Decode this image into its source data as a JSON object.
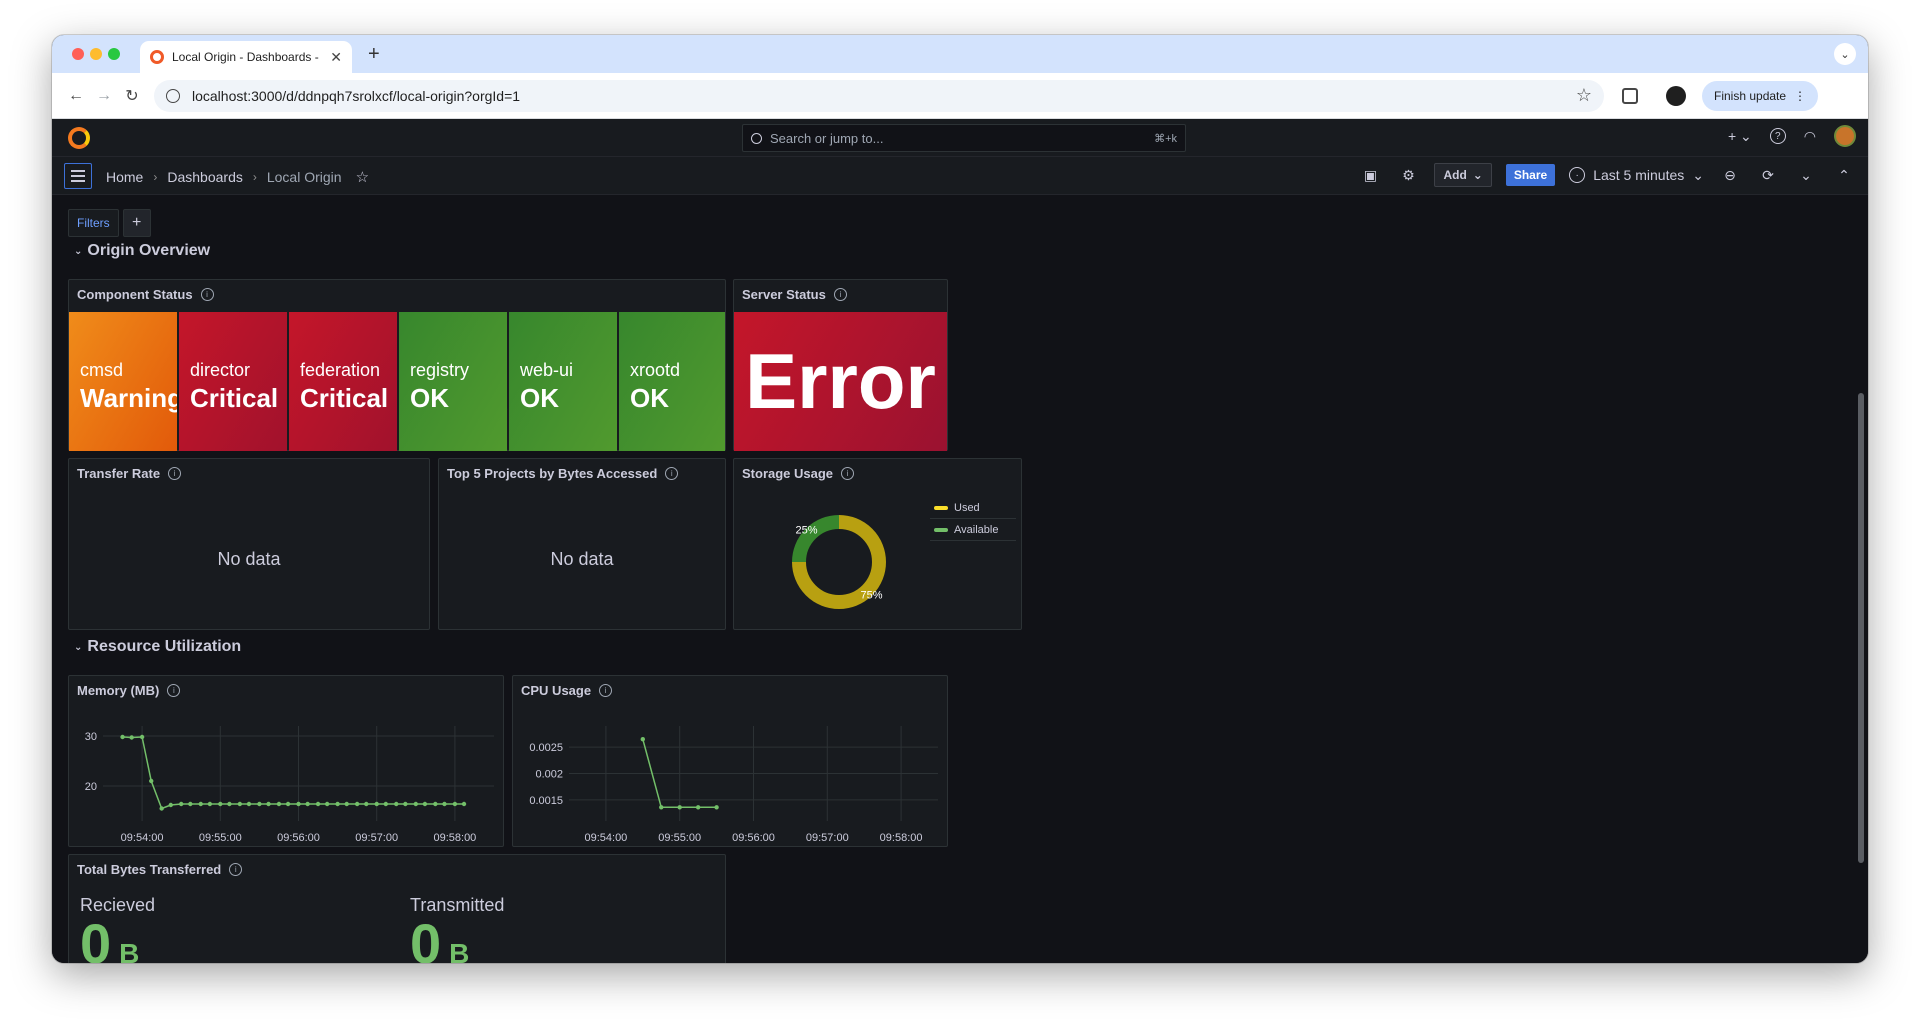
{
  "browser": {
    "tab_title": "Local Origin - Dashboards - Grafana",
    "url": "localhost:3000/d/ddnpqh7srolxcf/local-origin?orgId=1",
    "finish_update": "Finish update"
  },
  "grafana": {
    "search_placeholder": "Search or jump to...",
    "search_shortcut": "⌘+k",
    "breadcrumb": [
      "Home",
      "Dashboards",
      "Local Origin"
    ],
    "add_label": "Add",
    "share_label": "Share",
    "time_range": "Last 5 minutes",
    "filters_label": "Filters"
  },
  "rows": {
    "overview": "Origin Overview",
    "resources": "Resource Utilization"
  },
  "component_status": {
    "title": "Component Status",
    "tiles": [
      {
        "name": "cmsd",
        "value": "Warning",
        "color": "#e25a0a"
      },
      {
        "name": "director",
        "value": "Critical",
        "color": "#c4162a"
      },
      {
        "name": "federation",
        "value": "Critical",
        "color": "#c4162a"
      },
      {
        "name": "registry",
        "value": "OK",
        "color": "#37872d"
      },
      {
        "name": "web-ui",
        "value": "OK",
        "color": "#37872d"
      },
      {
        "name": "xrootd",
        "value": "OK",
        "color": "#37872d"
      }
    ]
  },
  "server_status": {
    "title": "Server Status",
    "value": "Error"
  },
  "transfer_rate": {
    "title": "Transfer Rate",
    "empty": "No data"
  },
  "top_projects": {
    "title": "Top 5 Projects by Bytes Accessed",
    "empty": "No data"
  },
  "storage_usage": {
    "title": "Storage Usage",
    "legend": [
      "Used",
      "Available"
    ],
    "slice_labels": [
      "75%",
      "25%"
    ]
  },
  "memory": {
    "title": "Memory (MB)"
  },
  "cpu": {
    "title": "CPU Usage"
  },
  "total_bytes": {
    "title": "Total Bytes Transferred",
    "received_label": "Recieved",
    "received_value": "0",
    "received_unit": "B",
    "transmitted_label": "Transmitted",
    "transmitted_value": "0",
    "transmitted_unit": "B"
  },
  "chart_data": [
    {
      "type": "pie",
      "title": "Storage Usage",
      "categories": [
        "Used",
        "Available"
      ],
      "values": [
        75,
        25
      ],
      "colors": [
        "#b8a011",
        "#37872d"
      ],
      "legend": "right"
    },
    {
      "type": "line",
      "title": "Memory (MB)",
      "x": [
        "09:53:45",
        "09:53:52",
        "09:54:00",
        "09:54:07",
        "09:54:15",
        "09:54:22",
        "09:54:30",
        "09:54:37",
        "09:54:45",
        "09:54:52",
        "09:55:00",
        "09:55:07",
        "09:55:15",
        "09:55:22",
        "09:55:30",
        "09:55:37",
        "09:55:45",
        "09:55:52",
        "09:56:00",
        "09:56:07",
        "09:56:15",
        "09:56:22",
        "09:56:30",
        "09:56:37",
        "09:56:45",
        "09:56:52",
        "09:57:00",
        "09:57:07",
        "09:57:15",
        "09:57:22",
        "09:57:30",
        "09:57:37",
        "09:57:45",
        "09:57:52",
        "09:58:00",
        "09:58:07"
      ],
      "series": [
        {
          "values": [
            29.8,
            29.7,
            29.8,
            21,
            15.5,
            16.2,
            16.4,
            16.4,
            16.4,
            16.4,
            16.4,
            16.4,
            16.4,
            16.4,
            16.4,
            16.4,
            16.4,
            16.4,
            16.4,
            16.4,
            16.4,
            16.4,
            16.4,
            16.4,
            16.4,
            16.4,
            16.4,
            16.4,
            16.4,
            16.4,
            16.4,
            16.4,
            16.4,
            16.4,
            16.4,
            16.4
          ],
          "color": "#73bf69"
        }
      ],
      "x_ticks": [
        "09:54:00",
        "09:55:00",
        "09:56:00",
        "09:57:00",
        "09:58:00"
      ],
      "y_ticks": [
        20,
        30
      ],
      "ylim": [
        13,
        32
      ]
    },
    {
      "type": "line",
      "title": "CPU Usage",
      "x": [
        "09:54:30",
        "09:54:45",
        "09:55:00",
        "09:55:15",
        "09:55:30"
      ],
      "series": [
        {
          "values": [
            0.00265,
            0.00136,
            0.00136,
            0.00136,
            0.00136
          ],
          "color": "#73bf69"
        }
      ],
      "x_ticks": [
        "09:54:00",
        "09:55:00",
        "09:56:00",
        "09:57:00",
        "09:58:00"
      ],
      "y_ticks": [
        0.0015,
        0.002,
        0.0025
      ],
      "ylim": [
        0.0011,
        0.0029
      ]
    }
  ]
}
